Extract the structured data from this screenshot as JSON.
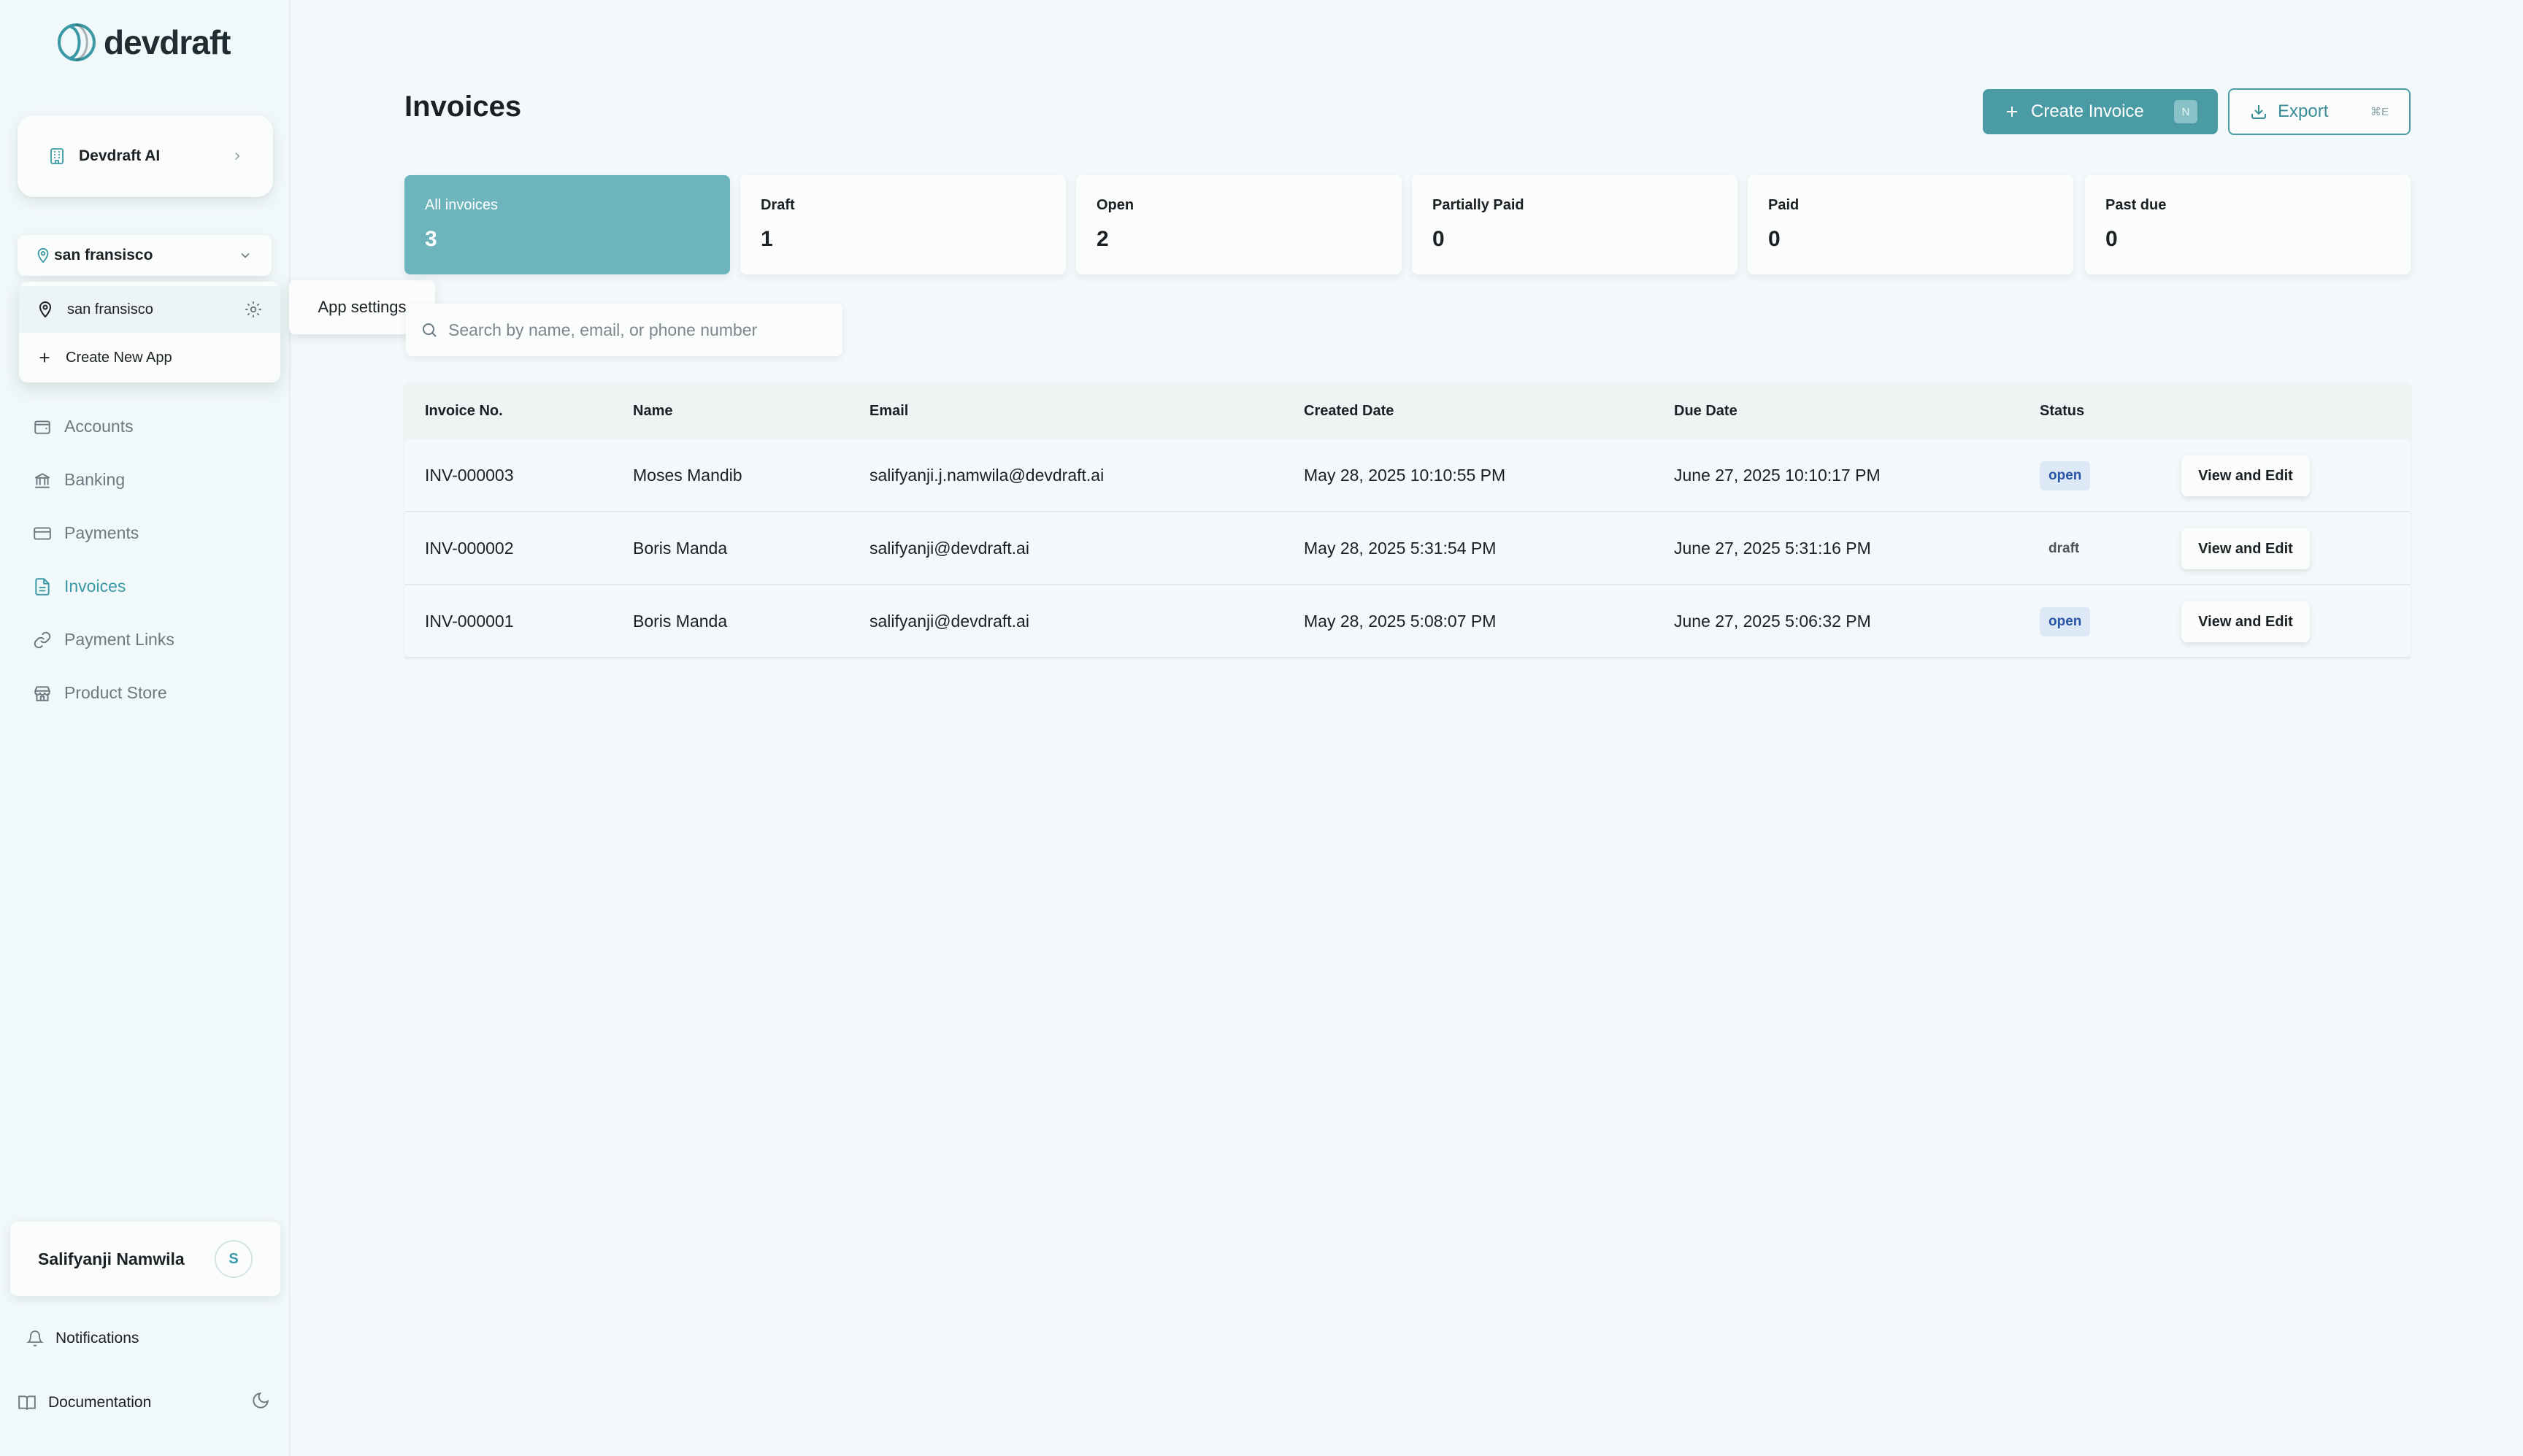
{
  "brand": {
    "name": "devdraft",
    "accent": "#4b9ba4"
  },
  "sidebar": {
    "org": {
      "label": "Devdraft AI",
      "icon": "building-icon"
    },
    "app_select": {
      "value": "san fransisco",
      "icon": "map-pin-icon"
    },
    "app_menu": {
      "active": "san fransisco",
      "create": "Create New App",
      "tooltip": "App settings"
    },
    "nav": [
      {
        "label": "Accounts",
        "icon": "wallet-icon",
        "active": false
      },
      {
        "label": "Banking",
        "icon": "bank-icon",
        "active": false
      },
      {
        "label": "Payments",
        "icon": "credit-card-icon",
        "active": false
      },
      {
        "label": "Invoices",
        "icon": "file-text-icon",
        "active": true
      },
      {
        "label": "Payment Links",
        "icon": "link-icon",
        "active": false
      },
      {
        "label": "Product Store",
        "icon": "store-icon",
        "active": false
      }
    ],
    "user": {
      "name": "Salifyanji Namwila",
      "initial": "S"
    },
    "notifications": "Notifications",
    "documentation": "Documentation"
  },
  "main": {
    "title": "Invoices",
    "create_button": {
      "label": "Create Invoice",
      "shortcut": "N"
    },
    "export_button": {
      "label": "Export",
      "shortcut": "⌘E"
    },
    "stats": [
      {
        "label": "All invoices",
        "value": "3",
        "active": true
      },
      {
        "label": "Draft",
        "value": "1",
        "active": false
      },
      {
        "label": "Open",
        "value": "2",
        "active": false
      },
      {
        "label": "Partially Paid",
        "value": "0",
        "active": false
      },
      {
        "label": "Paid",
        "value": "0",
        "active": false
      },
      {
        "label": "Past due",
        "value": "0",
        "active": false
      }
    ],
    "search": {
      "placeholder": "Search by name, email, or phone number",
      "value": ""
    },
    "table": {
      "headers": [
        "Invoice No.",
        "Name",
        "Email",
        "Created Date",
        "Due Date",
        "Status"
      ],
      "action_label": "View and Edit",
      "rows": [
        {
          "invoice": "INV-000003",
          "name": "Moses Mandib",
          "email": "salifyanji.j.namwila@devdraft.ai",
          "created": "May 28, 2025 10:10:55 PM",
          "due": "June 27, 2025 10:10:17 PM",
          "status": "open"
        },
        {
          "invoice": "INV-000002",
          "name": "Boris Manda",
          "email": "salifyanji@devdraft.ai",
          "created": "May 28, 2025 5:31:54 PM",
          "due": "June 27, 2025 5:31:16 PM",
          "status": "draft"
        },
        {
          "invoice": "INV-000001",
          "name": "Boris Manda",
          "email": "salifyanji@devdraft.ai",
          "created": "May 28, 2025 5:08:07 PM",
          "due": "June 27, 2025 5:06:32 PM",
          "status": "open"
        }
      ]
    }
  }
}
